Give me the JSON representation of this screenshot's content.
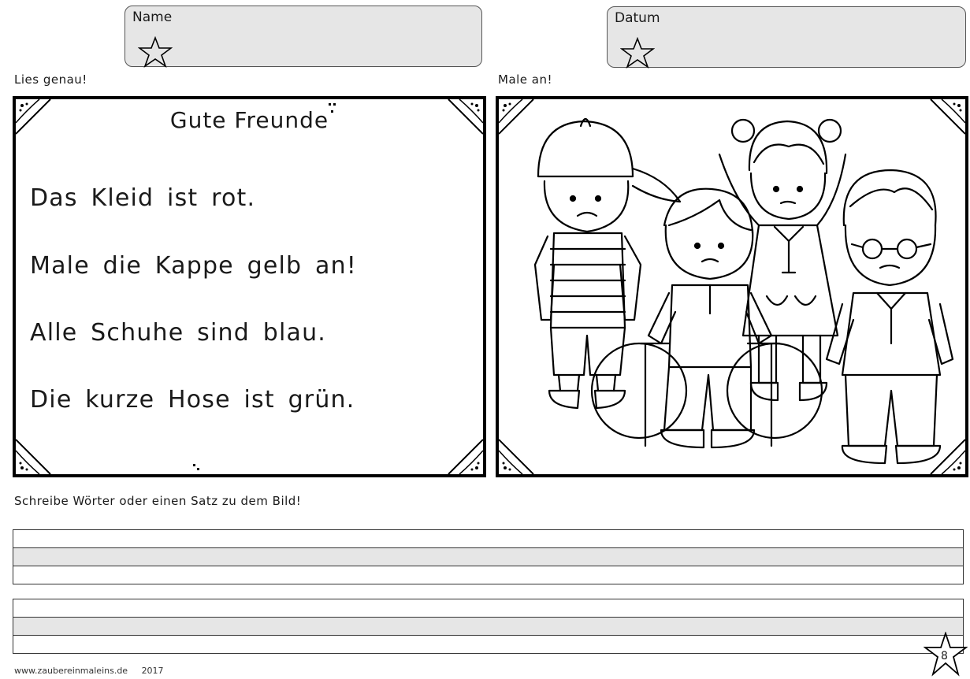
{
  "header": {
    "name_label": "Name",
    "date_label": "Datum"
  },
  "instructions": {
    "read": "Lies genau!",
    "color": "Male an!",
    "write": "Schreibe Wörter oder einen Satz zu dem Bild!"
  },
  "reading_card": {
    "title": "Gute Freunde",
    "sentences": [
      "Das Kleid ist rot.",
      "Male die Kappe gelb an!",
      "Alle Schuhe sind blau.",
      "Die kurze Hose ist grün."
    ]
  },
  "footer": {
    "website": "www.zaubereinmaleins.de",
    "year": "2017",
    "page_number": "8"
  },
  "icons": [
    "star-icon",
    "corner-ornament-icon"
  ],
  "colors": {
    "field_fill": "#e6e6e6",
    "border": "#000000"
  }
}
